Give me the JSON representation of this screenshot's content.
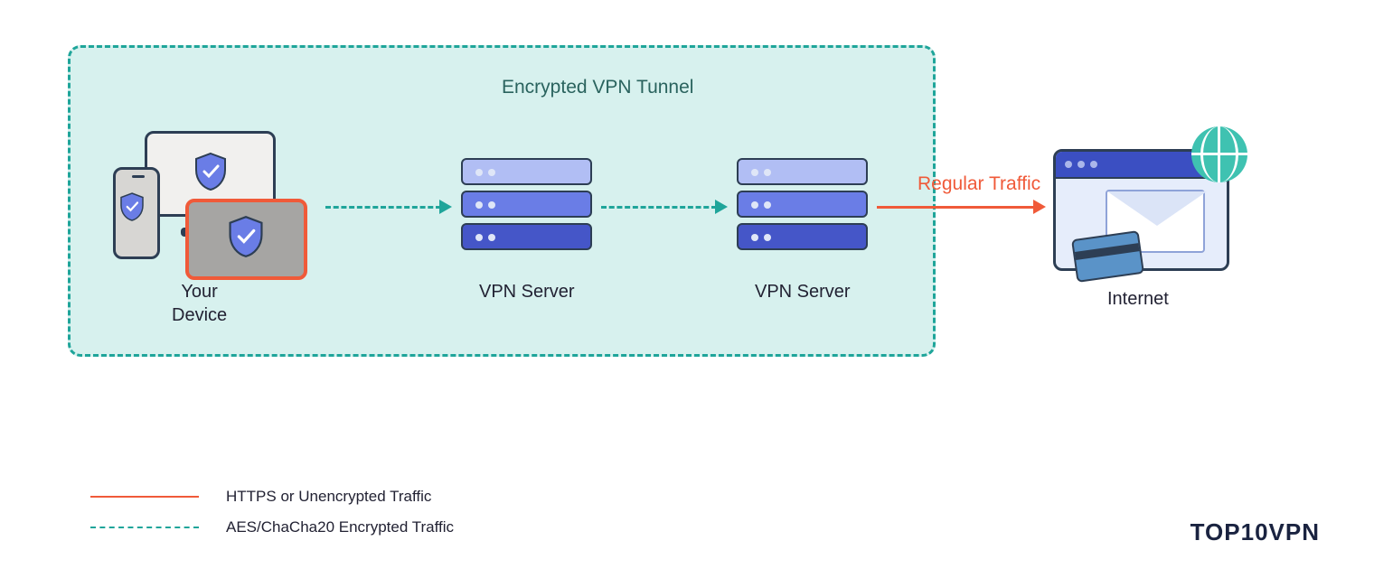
{
  "diagram": {
    "tunnel_title": "Encrypted VPN Tunnel",
    "nodes": {
      "device_label": "Your\nDevice",
      "server1_label": "VPN Server",
      "server2_label": "VPN Server",
      "internet_label": "Internet"
    },
    "arrows": {
      "regular_traffic_label": "Regular Traffic"
    }
  },
  "legend": {
    "items": [
      {
        "style": "solid",
        "color": "#f05a39",
        "label": "HTTPS or Unencrypted Traffic"
      },
      {
        "style": "dashed",
        "color": "#1fa59a",
        "label": "AES/ChaCha20 Encrypted Traffic"
      }
    ]
  },
  "branding": {
    "logo_text": "TOP10VPN"
  },
  "colors": {
    "teal": "#1fa59a",
    "teal_fill": "#d7f1ee",
    "orange": "#f05a39",
    "indigo_dark": "#4556c8",
    "indigo_mid": "#6a7de6",
    "indigo_light": "#b1bef4",
    "outline": "#2d3e54"
  },
  "chart_data": {
    "type": "diagram",
    "title": "Encrypted VPN Tunnel — Double-hop VPN flow",
    "nodes": [
      {
        "id": "device",
        "label": "Your Device"
      },
      {
        "id": "vpn1",
        "label": "VPN Server"
      },
      {
        "id": "vpn2",
        "label": "VPN Server"
      },
      {
        "id": "internet",
        "label": "Internet"
      }
    ],
    "edges": [
      {
        "from": "device",
        "to": "vpn1",
        "kind": "encrypted",
        "label": ""
      },
      {
        "from": "vpn1",
        "to": "vpn2",
        "kind": "encrypted",
        "label": ""
      },
      {
        "from": "vpn2",
        "to": "internet",
        "kind": "regular",
        "label": "Regular Traffic"
      }
    ],
    "tunnel_members": [
      "device",
      "vpn1",
      "vpn2"
    ],
    "legend": {
      "regular": "HTTPS or Unencrypted Traffic",
      "encrypted": "AES/ChaCha20 Encrypted Traffic"
    }
  }
}
